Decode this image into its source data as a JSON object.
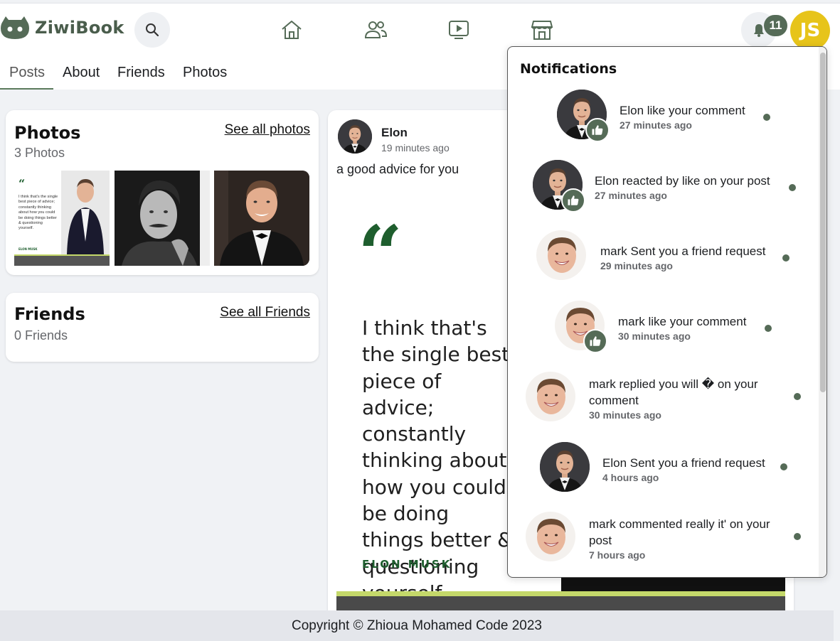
{
  "app": {
    "name": "ZiwiBook"
  },
  "header": {
    "notification_count": "11",
    "user_initials": "JS",
    "avatar_color": "#e7c41a",
    "brand_color": "#556b57",
    "nav": [
      {
        "icon": "home-icon"
      },
      {
        "icon": "friends-icon"
      },
      {
        "icon": "video-icon"
      },
      {
        "icon": "store-icon"
      }
    ]
  },
  "tabs": [
    "Posts",
    "About",
    "Friends",
    "Photos"
  ],
  "photos_card": {
    "title": "Photos",
    "count": "3 Photos",
    "link": "See all photos"
  },
  "friends_card": {
    "title": "Friends",
    "count": "0 Friends",
    "link": "See all Friends"
  },
  "post": {
    "author": "Elon",
    "time": "19 minutes ago",
    "text": "a good advice for you",
    "quote_mark": "“",
    "quote": "I think that's the single best piece of advice; constantly thinking about how you could be doing things better & questioning yourself.",
    "signature": "ELON MUSK",
    "thumb_quote": "I think that's the single best piece of advice; constantly thinking about how you could be doing things better & questioning yourself.",
    "thumb_sig": "ELON MUSK"
  },
  "notifications": {
    "heading": "Notifications",
    "items": [
      {
        "text": "Elon like your comment",
        "time": "27 minutes ago",
        "avatar": "elon",
        "like": true
      },
      {
        "text": "Elon reacted by like on your post",
        "time": "27 minutes ago",
        "avatar": "elon",
        "like": true
      },
      {
        "text": "mark Sent you a friend request",
        "time": "29 minutes ago",
        "avatar": "mark",
        "like": false
      },
      {
        "text": "mark like your comment",
        "time": "30 minutes ago",
        "avatar": "mark",
        "like": true
      },
      {
        "text": "mark replied you will � on your comment",
        "time": "30 minutes ago",
        "avatar": "mark",
        "like": false
      },
      {
        "text": "Elon Sent you a friend request",
        "time": "4 hours ago",
        "avatar": "elon",
        "like": false
      },
      {
        "text": "mark commented really it' on your post",
        "time": "7 hours ago",
        "avatar": "mark",
        "like": false
      }
    ]
  },
  "footer": {
    "text": "Copyright © Zhioua Mohamed Code 2023"
  }
}
